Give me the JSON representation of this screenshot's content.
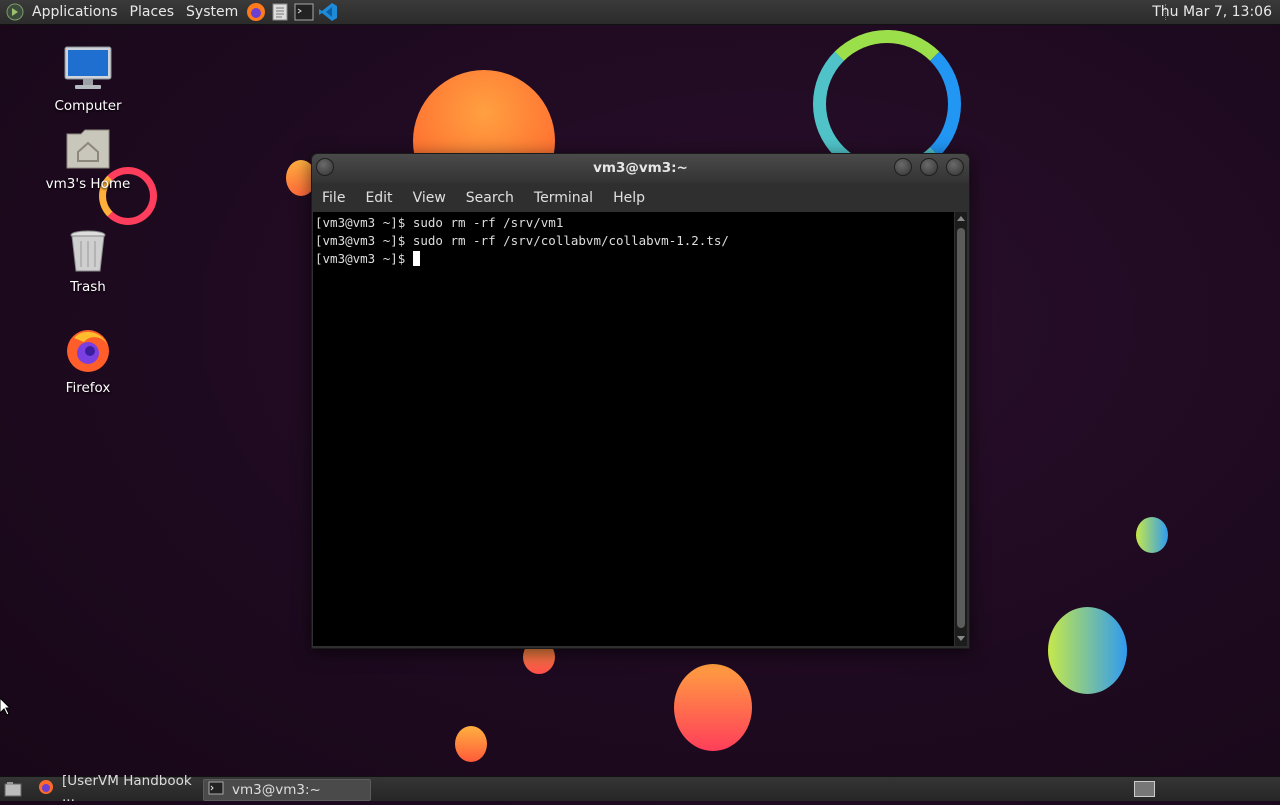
{
  "top_panel": {
    "menus": [
      "Applications",
      "Places",
      "System"
    ],
    "launchers": [
      "firefox-icon",
      "text-editor-icon",
      "terminal-icon",
      "vscode-icon"
    ],
    "clock": "Thu Mar  7, 13:06"
  },
  "desktop_icons": [
    {
      "label": "Computer",
      "icon": "computer-icon"
    },
    {
      "label": "vm3's Home",
      "icon": "home-folder-icon"
    },
    {
      "label": "Trash",
      "icon": "trash-icon"
    },
    {
      "label": "Firefox",
      "icon": "firefox-icon"
    }
  ],
  "terminal": {
    "title": "vm3@vm3:~",
    "menus": [
      "File",
      "Edit",
      "View",
      "Search",
      "Terminal",
      "Help"
    ],
    "lines": [
      "[vm3@vm3 ~]$ sudo rm -rf /srv/vm1",
      "[vm3@vm3 ~]$ sudo rm -rf /srv/collabvm/collabvm-1.2.ts/",
      "[vm3@vm3 ~]$ "
    ]
  },
  "taskbar": {
    "tasks": [
      {
        "label": "[UserVM Handbook ...",
        "icon": "firefox-icon",
        "active": false
      },
      {
        "label": "vm3@vm3:~",
        "icon": "terminal-icon",
        "active": true
      }
    ]
  },
  "colors": {
    "accent": "#ff7b3a",
    "desktop_bg": "#1e0a20"
  }
}
